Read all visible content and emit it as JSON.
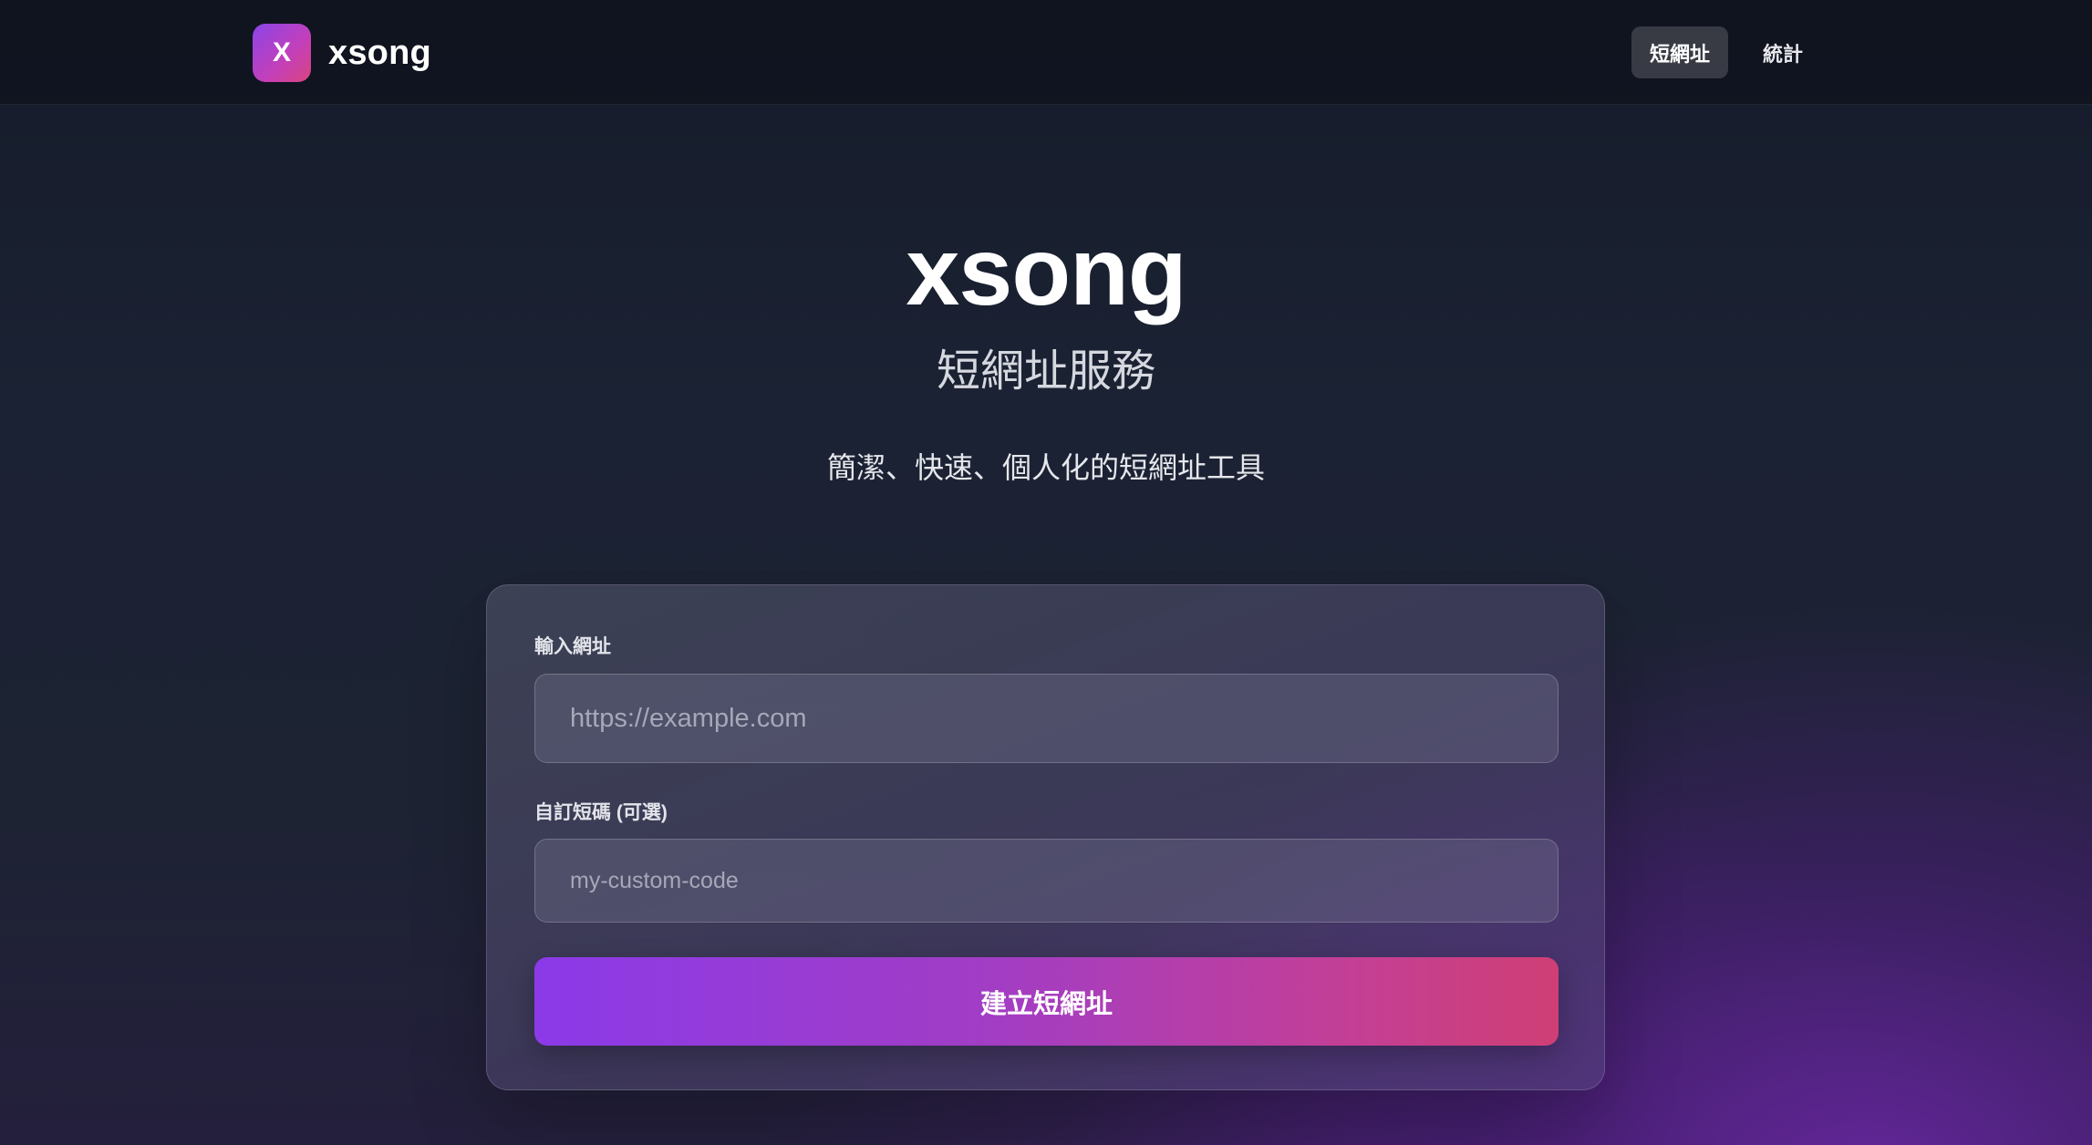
{
  "header": {
    "logo_letter": "X",
    "brand_name": "xsong",
    "nav": [
      {
        "label": "短網址",
        "active": true
      },
      {
        "label": "統計",
        "active": false
      }
    ]
  },
  "hero": {
    "title": "xsong",
    "subtitle": "短網址服務",
    "tagline": "簡潔、快速、個人化的短網址工具"
  },
  "form": {
    "url_label": "輸入網址",
    "url_placeholder": "https://example.com",
    "url_value": "",
    "code_label": "自訂短碼 (可選)",
    "code_placeholder": "my-custom-code",
    "code_value": "",
    "submit_label": "建立短網址"
  },
  "colors": {
    "accent_start": "#8b3ae8",
    "accent_end": "#cf3f75",
    "background": "#1b2233"
  },
  "icons": {
    "logo": "x-letter-logo-icon"
  }
}
